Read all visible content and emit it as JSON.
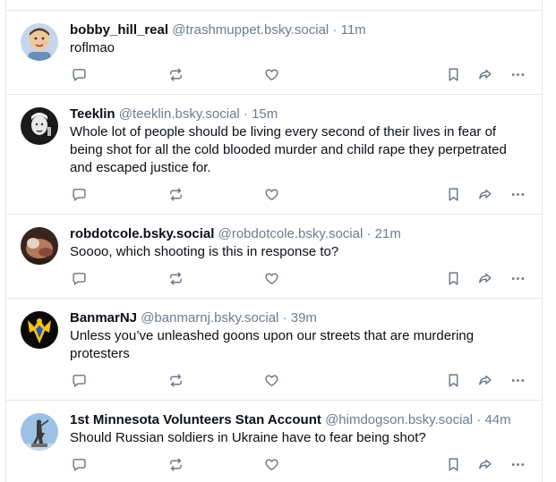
{
  "colors": {
    "border": "#e3e6ea",
    "muted": "#6f7c8b",
    "icon": "#6b7684",
    "text": "#0b0f14"
  },
  "icons": [
    "reply-icon",
    "repost-icon",
    "like-icon",
    "bookmark-icon",
    "share-icon",
    "more-icon"
  ],
  "posts": [
    {
      "name": "bobby_hill_real",
      "handle": "@trashmuppet.bsky.social",
      "dot": "·",
      "time": "11m",
      "text": "roflmao"
    },
    {
      "name": "Teeklin",
      "handle": "@teeklin.bsky.social",
      "dot": "·",
      "time": "15m",
      "text": "Whole lot of people should be living every second of their lives in fear of being shot for all the cold blooded murder and child rape they perpetrated and escaped justice for."
    },
    {
      "name": "robdotcole.bsky.social",
      "handle": "@robdotcole.bsky.social",
      "dot": "·",
      "time": "21m",
      "text": "Soooo, which shooting is this in response to?"
    },
    {
      "name": "BanmarNJ",
      "handle": "@banmarnj.bsky.social",
      "dot": "·",
      "time": "39m",
      "text": "Unless you’ve unleashed goons upon our streets that are murdering protesters"
    },
    {
      "name": "1st Minnesota Volunteers Stan Account",
      "handle": "@himdogson.bsky.social",
      "dot": "·",
      "time": "44m",
      "text": "Should Russian soldiers in Ukraine have to fear being shot?"
    }
  ]
}
